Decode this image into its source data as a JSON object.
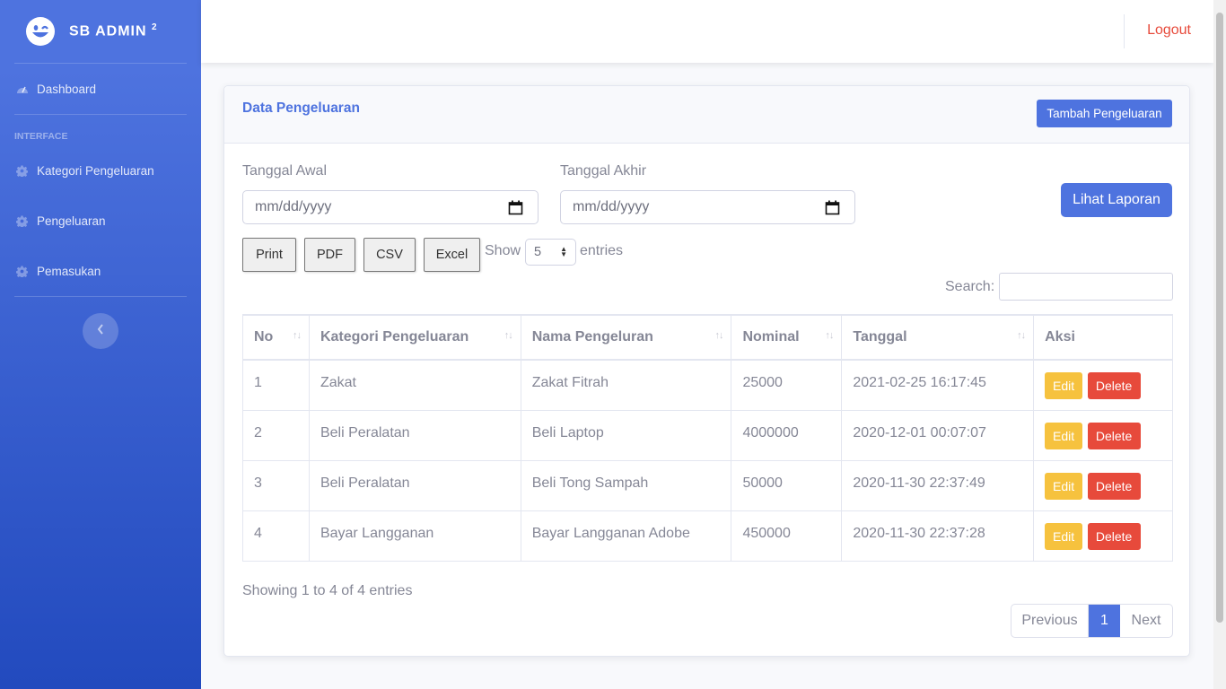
{
  "sidebar": {
    "brand": "SB ADMIN",
    "brand_sup": "2",
    "dashboard": "Dashboard",
    "heading": "INTERFACE",
    "items": [
      {
        "label": "Kategori Pengeluaran"
      },
      {
        "label": "Pengeluaran"
      },
      {
        "label": "Pemasukan"
      }
    ]
  },
  "topbar": {
    "logout": "Logout"
  },
  "card": {
    "title": "Data Pengeluaran",
    "add_button": "Tambah Pengeluaran"
  },
  "filters": {
    "start_label": "Tanggal Awal",
    "start_placeholder": "mm/dd/yyyy",
    "end_label": "Tanggal Akhir",
    "end_placeholder": "mm/dd/yyyy",
    "report_button": "Lihat Laporan"
  },
  "export_buttons": [
    "Print",
    "PDF",
    "CSV",
    "Excel"
  ],
  "length": {
    "prefix": "Show",
    "value": "5",
    "suffix": "entries"
  },
  "search": {
    "label": "Search:"
  },
  "table": {
    "headers": [
      "No",
      "Kategori Pengeluaran",
      "Nama Pengeluran",
      "Nominal",
      "Tanggal",
      "Aksi"
    ],
    "rows": [
      [
        "1",
        "Zakat",
        "Zakat Fitrah",
        "25000",
        "2021-02-25 16:17:45"
      ],
      [
        "2",
        "Beli Peralatan",
        "Beli Laptop",
        "4000000",
        "2020-12-01 00:07:07"
      ],
      [
        "3",
        "Beli Peralatan",
        "Beli Tong Sampah",
        "50000",
        "2020-11-30 22:37:49"
      ],
      [
        "4",
        "Bayar Langganan",
        "Bayar Langganan Adobe",
        "450000",
        "2020-11-30 22:37:28"
      ]
    ],
    "edit_label": "Edit",
    "delete_label": "Delete"
  },
  "info": "Showing 1 to 4 of 4 entries",
  "pagination": {
    "previous": "Previous",
    "current": "1",
    "next": "Next"
  },
  "colors": {
    "primary": "#4e73df",
    "warning": "#f6c23e",
    "danger": "#e74a3b"
  }
}
